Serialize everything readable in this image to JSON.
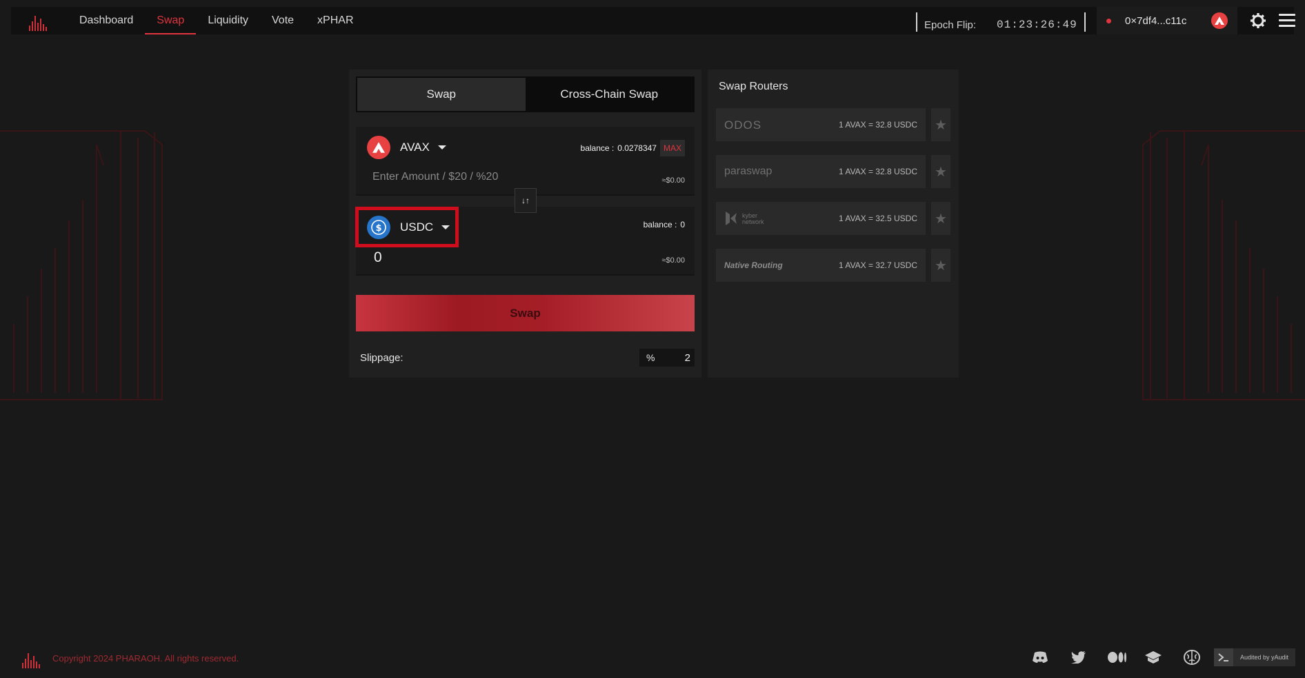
{
  "nav": {
    "items": [
      {
        "label": "Dashboard",
        "active": false
      },
      {
        "label": "Swap",
        "active": true
      },
      {
        "label": "Liquidity",
        "active": false
      },
      {
        "label": "Vote",
        "active": false
      },
      {
        "label": "xPHAR",
        "active": false
      }
    ],
    "epoch_label": "Epoch Flip:",
    "epoch_time": "01:23:26:49",
    "wallet_address": "0×7df4...c11c"
  },
  "swap": {
    "tabs": [
      "Swap",
      "Cross-Chain Swap"
    ],
    "active_tab": "Swap",
    "from": {
      "token": "AVAX",
      "token_icon": "avax-icon",
      "balance_label": "balance :",
      "balance": "0.0278347",
      "max_label": "MAX",
      "amount_placeholder": "Enter Amount / $20 / %20",
      "amount_value": "",
      "usd_value": "≈$0.00"
    },
    "to": {
      "token": "USDC",
      "token_icon": "usdc-icon",
      "balance_label": "balance :",
      "balance": "0",
      "amount": "0",
      "usd_value": "≈$0.00"
    },
    "switch_label": "↓↑",
    "button_label": "Swap",
    "slippage_label": "Slippage:",
    "slippage_unit": "%",
    "slippage_value": "2"
  },
  "routers": {
    "title": "Swap Routers",
    "items": [
      {
        "name": "ODOS",
        "rate": "1 AVAX = 32.8 USDC"
      },
      {
        "name": "paraswap",
        "rate": "1 AVAX = 32.8 USDC"
      },
      {
        "name": "kyber network",
        "rate": "1 AVAX = 32.5 USDC"
      },
      {
        "name": "Native Routing",
        "rate": "1 AVAX = 32.7 USDC"
      }
    ]
  },
  "footer": {
    "copyright": "Copyright 2024 PHARAOH. All rights reserved.",
    "social": [
      "discord-icon",
      "twitter-icon",
      "medium-icon",
      "docs-icon",
      "brain-icon"
    ],
    "audit_label": "Audited by yAudit"
  },
  "colors": {
    "accent": "#e0343f",
    "background": "#191919",
    "card": "#202020",
    "highlight": "#d00d1c"
  }
}
